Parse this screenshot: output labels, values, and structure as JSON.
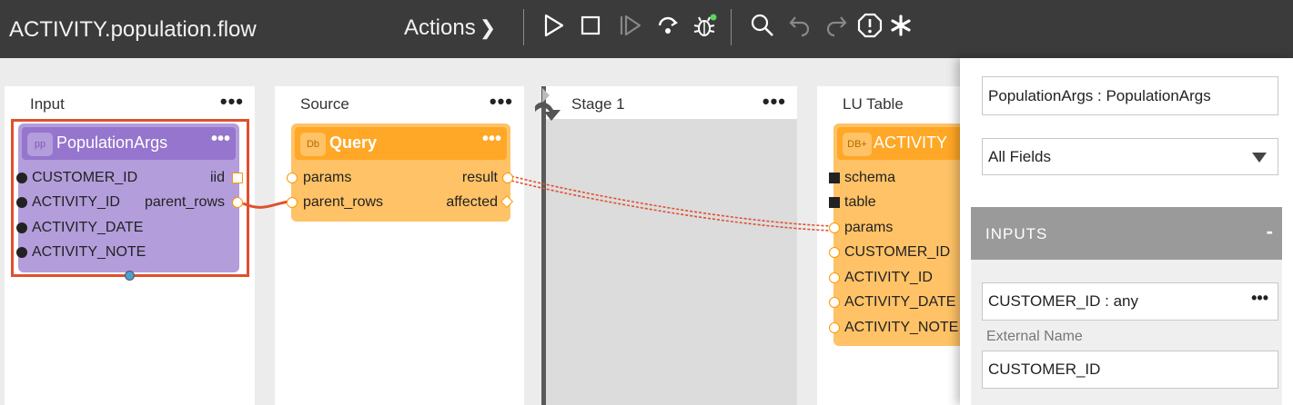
{
  "topbar": {
    "title": "ACTIVITY.population.flow",
    "actions_label": "Actions",
    "actions_chevron": "❯",
    "buttons": [
      "play-icon",
      "stop-icon",
      "step-icon",
      "step-over-icon",
      "debug-icon",
      "search-icon",
      "undo-icon",
      "redo-icon",
      "warning-icon",
      "asterisk-icon"
    ],
    "debug_indicator_color": "#5cd65c"
  },
  "lanes": {
    "input": {
      "title": "Input",
      "menu": "•••"
    },
    "source": {
      "title": "Source",
      "menu": "•••"
    },
    "stage1": {
      "title": "Stage 1",
      "menu": "•••"
    },
    "lu_table": {
      "title": "LU Table",
      "menu": "•••"
    }
  },
  "nodes": {
    "population_args": {
      "badge": "pp",
      "name": "PopulationArgs",
      "menu": "•••",
      "left_ports": [
        "CUSTOMER_ID",
        "ACTIVITY_ID",
        "ACTIVITY_DATE",
        "ACTIVITY_NOTE"
      ],
      "right_ports": [
        "iid",
        "parent_rows"
      ]
    },
    "query": {
      "badge": "Db",
      "name": "Query",
      "menu": "•••",
      "left_ports": [
        "params",
        "parent_rows"
      ],
      "right_ports": [
        "result",
        "affected"
      ]
    },
    "activity": {
      "badge": "DB+",
      "name": "ACTIVITY",
      "ports": [
        "schema",
        "table",
        "params",
        "CUSTOMER_ID",
        "ACTIVITY_ID",
        "ACTIVITY_DATE",
        "ACTIVITY_NOTE"
      ]
    }
  },
  "panel": {
    "name_value": "PopulationArgs : PopulationArgs",
    "filter_value": "All Fields",
    "inputs_title": "INPUTS",
    "inputs_toggle": "-",
    "input_item_value": "CUSTOMER_ID : any",
    "input_item_menu": "•••",
    "external_name_label": "External Name",
    "external_name_value": "CUSTOMER_ID"
  },
  "colors": {
    "topbar": "#3b3b3b",
    "purple_node": "#b39ddb",
    "purple_head": "#9575cd",
    "orange_node": "#ffc266",
    "orange_head": "#ffa726",
    "selection": "#e0502e",
    "link": "#e0502e"
  }
}
